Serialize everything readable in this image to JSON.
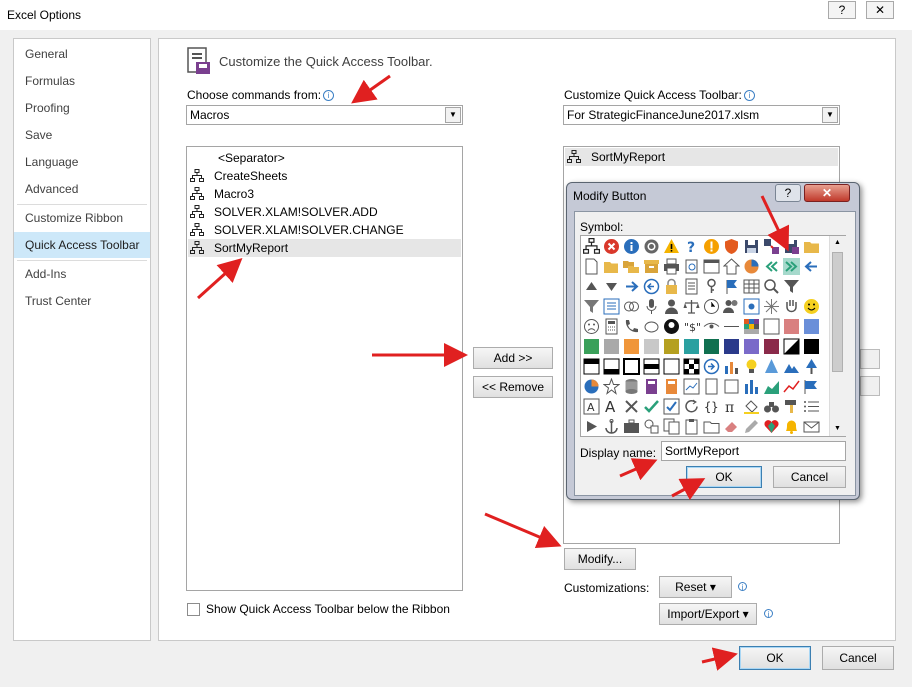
{
  "window": {
    "title": "Excel Options",
    "help_label": "?",
    "close_label": "✕"
  },
  "sidebar": {
    "items": [
      {
        "label": "General"
      },
      {
        "label": "Formulas"
      },
      {
        "label": "Proofing"
      },
      {
        "label": "Save"
      },
      {
        "label": "Language"
      },
      {
        "label": "Advanced"
      },
      {
        "label": "Customize Ribbon"
      },
      {
        "label": "Quick Access Toolbar",
        "selected": true
      },
      {
        "label": "Add-Ins"
      },
      {
        "label": "Trust Center"
      }
    ]
  },
  "main": {
    "heading": "Customize the Quick Access Toolbar.",
    "choose_label": "Choose commands from:",
    "choose_value": "Macros",
    "commands": [
      {
        "label": "<Separator>",
        "icon": "none"
      },
      {
        "label": "CreateSheets",
        "icon": "macro-icon"
      },
      {
        "label": "Macro3",
        "icon": "macro-icon"
      },
      {
        "label": "SOLVER.XLAM!SOLVER.ADD",
        "icon": "macro-icon"
      },
      {
        "label": "SOLVER.XLAM!SOLVER.CHANGE",
        "icon": "macro-icon"
      },
      {
        "label": "SortMyReport",
        "icon": "macro-icon",
        "selected": true
      }
    ],
    "add_button": "Add >>",
    "remove_button": "<< Remove",
    "show_below_label": "Show Quick Access Toolbar below the Ribbon",
    "show_below_checked": false,
    "customize_label": "Customize Quick Access Toolbar:",
    "customize_value": "For StrategicFinanceJune2017.xlsm",
    "toolbar_items": [
      {
        "label": "SortMyReport",
        "icon": "macro-icon"
      }
    ],
    "modify_button": "Modify...",
    "customizations_label": "Customizations:",
    "reset_button": "Reset ▾",
    "import_export_button": "Import/Export ▾"
  },
  "footer": {
    "ok_button": "OK",
    "cancel_button": "Cancel"
  },
  "modify_dialog": {
    "title": "Modify Button",
    "help_label": "?",
    "close_label": "✕",
    "symbol_label": "Symbol:",
    "display_name_label": "Display name:",
    "display_name_value": "SortMyReport",
    "ok_button": "OK",
    "cancel_button": "Cancel",
    "selected_symbol": "arrow-right-icon"
  },
  "colors": {
    "selection": "#cde8f9",
    "accent_red": "#e02020",
    "blue_icon": "#2a6ebb"
  }
}
